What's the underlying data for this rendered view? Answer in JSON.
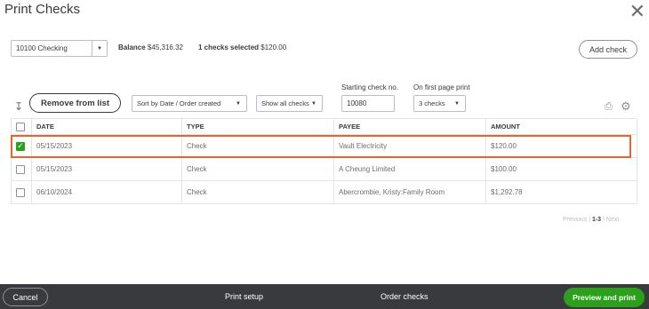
{
  "window": {
    "title": "Print Checks",
    "close_symbol": "✕"
  },
  "account": {
    "selected": "10100 Checking"
  },
  "summary": {
    "balance_label": "Balance",
    "balance_value": "$45,316.32",
    "selected_label": "1 checks selected",
    "selected_value": "$120.00"
  },
  "buttons": {
    "add_check": "Add check",
    "remove_from_list": "Remove from list"
  },
  "filters": {
    "sort": "Sort by Date / Order created",
    "show": "Show all checks",
    "starting_check_label": "Starting check no.",
    "starting_check_value": "10080",
    "first_page_label": "On first page print",
    "first_page_value": "3 checks"
  },
  "table": {
    "headers": {
      "date": "DATE",
      "type": "TYPE",
      "payee": "PAYEE",
      "amount": "AMOUNT"
    },
    "rows": [
      {
        "checked": true,
        "date": "05/15/2023",
        "type": "Check",
        "payee": "Vault Electricity",
        "amount": "$120.00"
      },
      {
        "checked": false,
        "date": "05/15/2023",
        "type": "Check",
        "payee": "A Cheung Limited",
        "amount": "$100.00"
      },
      {
        "checked": false,
        "date": "06/10/2024",
        "type": "Check",
        "payee": "Abercrombie, Kristy:Family Room",
        "amount": "$1,292.78"
      }
    ]
  },
  "pager": {
    "previous": "Previous",
    "range": "1-3",
    "next": "Next"
  },
  "footer": {
    "cancel": "Cancel",
    "print_setup": "Print setup",
    "order_checks": "Order checks",
    "preview_and_print": "Preview and print"
  },
  "colors": {
    "accent_green": "#2ca01c",
    "highlight_orange": "#e0682f",
    "footer_bg": "#393a3d"
  },
  "icons": [
    "close-icon",
    "chevron-down-icon",
    "sort-arrow-icon",
    "printer-icon",
    "gear-icon",
    "checkmark-icon"
  ]
}
